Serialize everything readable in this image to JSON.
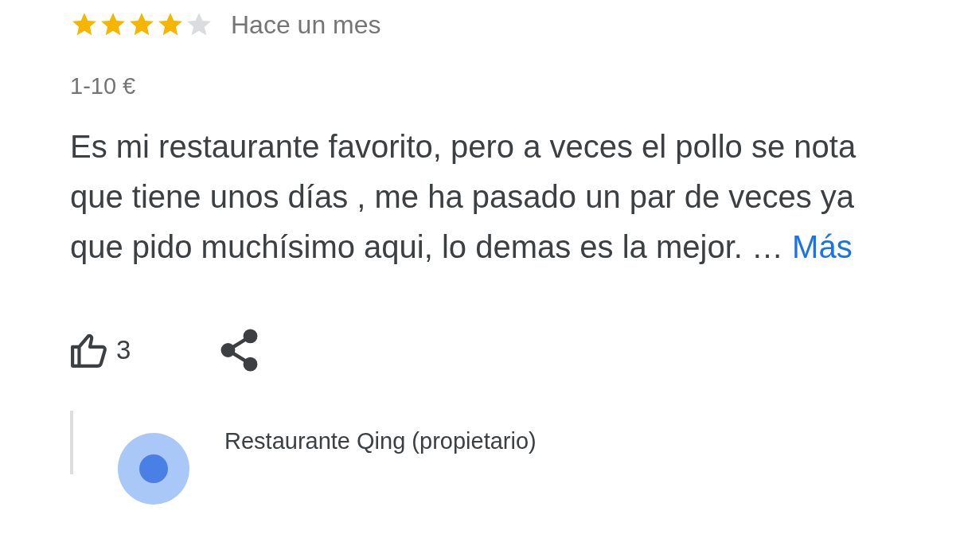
{
  "review": {
    "stars": 4,
    "time": "Hace un mes",
    "price": "1-10 €",
    "text": "Es mi restaurante favorito, pero a veces el pollo se nota que tiene unos días , me ha pasado un par de veces ya que pido muchísimo aqui, lo demas es la mejor. …",
    "more_link": "Más",
    "likes": "3"
  },
  "owner_reply": {
    "name": "Restaurante Qing (propietario)"
  }
}
